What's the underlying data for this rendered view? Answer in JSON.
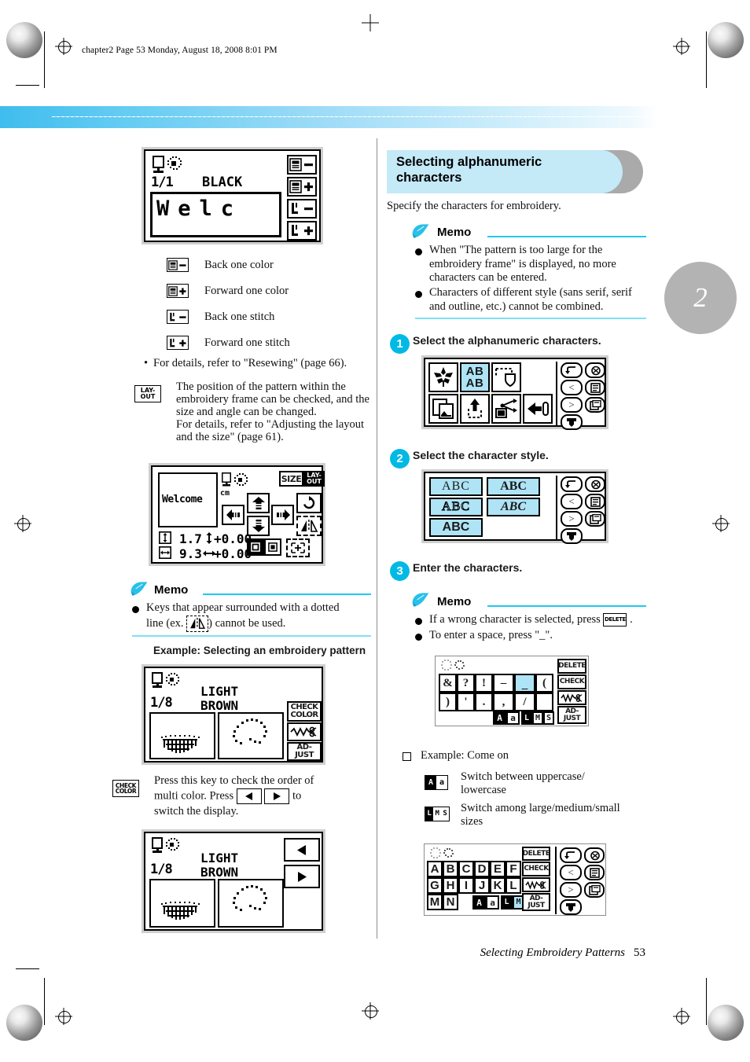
{
  "page": {
    "header_line": "chapter2  Page 53  Monday, August 18, 2008  8:01 PM",
    "chapter_marker": "2",
    "footer_title": "Selecting Embroidery Patterns",
    "footer_page": "53"
  },
  "left": {
    "screen_resew": {
      "page_counter": "1/1",
      "color_name": "BLACK",
      "preview_text": "Welc",
      "keys": [
        "back-one-color",
        "forward-one-color",
        "back-one-stitch",
        "forward-one-stitch"
      ]
    },
    "key_legend": [
      {
        "icon": "back-one-color-icon",
        "label": "Back one color"
      },
      {
        "icon": "forward-one-color-icon",
        "label": "Forward one color"
      },
      {
        "icon": "back-one-stitch-icon",
        "label": "Back one stitch"
      },
      {
        "icon": "forward-one-stitch-icon",
        "label": "Forward one stitch"
      }
    ],
    "resew_note": "For details, refer to \"Resewing\" (page 66).",
    "layout_key_label_line1": "LAY-",
    "layout_key_label_line2": "OUT",
    "layout_paragraph": "The position of the pattern within the embroidery frame can be checked, and the size and angle can be changed.",
    "layout_paragraph2": "For details, refer to \"Adjusting the layout and the size\" (page 61).",
    "screen_layout": {
      "preview_text": "Welcome",
      "unit": "cm",
      "size_key": "SIZE",
      "layout_key_line1": "LAY-",
      "layout_key_line2": "OUT",
      "height_value": "1.7",
      "height_offset": "+0.00",
      "width_value": "9.3",
      "width_offset": "+0.00"
    },
    "memo": {
      "title": "Memo",
      "items": [
        "Keys that appear surrounded with a dotted line (ex.     ) cannot be used."
      ],
      "item_prefix": "Keys that appear surrounded with a dotted",
      "item_line2a": "line (ex. ",
      "item_line2b": ") cannot be used."
    },
    "example_title": "Example: Selecting an embroidery pattern",
    "screen_check_a": {
      "page_counter": "1/8",
      "color_line1": "LIGHT",
      "color_line2": "BROWN",
      "key_check_line1": "CHECK",
      "key_check_line2": "COLOR",
      "key_thread": "thread-cut-icon",
      "key_adjust_line1": "AD-",
      "key_adjust_line2": "JUST"
    },
    "check_note_line1": "Press this key to check the order of",
    "check_note_line2a": "multi color. Press",
    "check_note_line2b": "to",
    "check_note_line3": "switch the display.",
    "check_color_key_line1": "CHECK",
    "check_color_key_line2": "COLOR",
    "screen_check_b": {
      "page_counter": "1/8",
      "color_line1": "LIGHT",
      "color_line2": "BROWN",
      "key_prev": "prev-arrow-icon",
      "key_next": "next-arrow-icon"
    }
  },
  "right": {
    "heading_line1": "Selecting alphanumeric",
    "heading_line2": "characters",
    "intro": "Specify the characters for embroidery.",
    "memo1": {
      "title": "Memo",
      "items": [
        "When \"The pattern is too large for the embroidery frame\" is displayed, no more characters can be entered.",
        "Characters of different style (sans serif, serif and outline, etc.) cannot be combined."
      ],
      "item1_l1": "When \"The pattern is too large for the",
      "item1_l2": "embroidery frame\" is displayed, no more",
      "item1_l3": "characters can be entered.",
      "item2_l1": "Characters of different style (sans serif, serif",
      "item2_l2": "and outline, etc.) cannot be combined."
    },
    "steps": [
      {
        "num": "1",
        "text": "Select the alphanumeric characters."
      },
      {
        "num": "2",
        "text": "Select the character style."
      },
      {
        "num": "3",
        "text": "Enter the characters."
      }
    ],
    "screen_categories": {
      "keys_row1": [
        "floral-pattern-icon",
        "AB AB",
        "frame-pattern-icon"
      ],
      "ab_key_line1": "AB",
      "ab_key_line2": "AB",
      "keys_row2": [
        "copy-icon",
        "pocket-icon",
        "usb-icon",
        "memory-icon"
      ],
      "side_keys": [
        "return-icon",
        "prev-icon",
        "next-icon",
        "set-icon",
        "needle-icon",
        "manual-icon",
        "book-icon"
      ]
    },
    "screen_styles": {
      "styles": [
        "ABC",
        "ABC",
        "ABC",
        "ABC",
        "ABC"
      ],
      "style_names": [
        "sans-serif",
        "bold-serif",
        "outline",
        "script",
        "bold-block"
      ]
    },
    "memo2": {
      "title": "Memo",
      "item1a": "If a wrong character is selected, press",
      "item1b": ".",
      "delete_key": "DELETE",
      "item2": "To enter a space, press \"_\"."
    },
    "screen_symbols": {
      "row1": [
        "&",
        "?",
        "!",
        "–",
        "_",
        "("
      ],
      "row2": [
        ")",
        "'",
        ".",
        ",",
        "/"
      ],
      "selected_index": 4,
      "key_delete": "DELETE",
      "key_check": "CHECK",
      "key_thread": "thread-cut-icon",
      "key_adjust_line1": "AD-",
      "key_adjust_line2": "JUST",
      "key_case_upper": "A",
      "key_case_lower": "a",
      "key_size_l": "L",
      "key_size_m": "M",
      "key_size_s": "S"
    },
    "example_label": "Example: Come on",
    "key_help": [
      {
        "icon": "case-switch-icon",
        "line1": "Switch between uppercase/",
        "line2": "lowercase"
      },
      {
        "icon": "size-switch-icon",
        "line1": "Switch among large/medium/small",
        "line2": "sizes"
      }
    ],
    "screen_alphabet": {
      "row1": [
        "A",
        "B",
        "C",
        "D",
        "E",
        "F"
      ],
      "row2": [
        "G",
        "H",
        "I",
        "J",
        "K",
        "L"
      ],
      "row3": [
        "M",
        "N"
      ],
      "key_delete": "DELETE",
      "key_check": "CHECK",
      "key_thread": "thread-cut-icon",
      "key_adjust_line1": "AD-",
      "key_adjust_line2": "JUST",
      "key_case_upper": "A",
      "key_case_lower": "a",
      "key_size_l": "L",
      "key_size_m": "M",
      "key_size_s": "S",
      "size_selected": "MS"
    }
  },
  "colors": {
    "accent_cyan": "#00b9e4",
    "banner_blue": "#c4e9f7",
    "lcd_highlight": "#aee4f5",
    "chapter_gray": "#b3b3b3"
  }
}
